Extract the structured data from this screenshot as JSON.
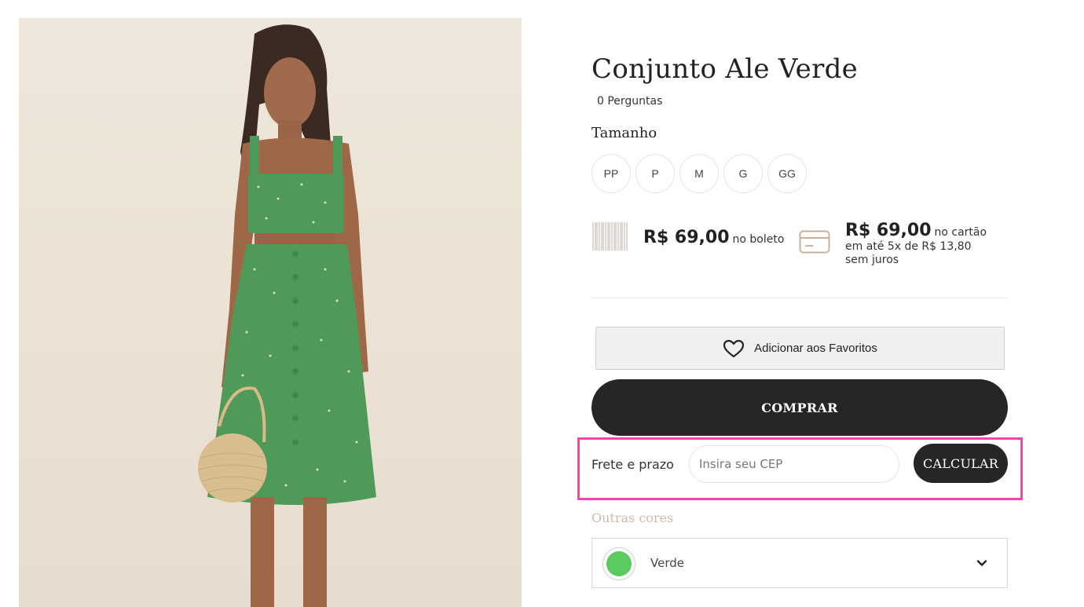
{
  "product": {
    "title": "Conjunto Ale Verde",
    "questions": "0 Perguntas",
    "size_label": "Tamanho",
    "sizes": [
      "PP",
      "P",
      "M",
      "G",
      "GG"
    ]
  },
  "pricing": {
    "boleto_price": "R$ 69,00",
    "boleto_note": "no boleto",
    "card_price": "R$ 69,00",
    "card_note": "no cartão",
    "installments": "em até 5x de R$ 13,80",
    "interest": "sem juros"
  },
  "actions": {
    "favorite_label": "Adicionar aos Favoritos",
    "buy_label": "COMPRAR"
  },
  "shipping": {
    "label": "Frete e prazo",
    "cep_placeholder": "Insira seu CEP",
    "calculate_label": "CALCULAR"
  },
  "colors": {
    "label": "Outras cores",
    "selected": "Verde",
    "swatch_color": "#5ccb5f"
  },
  "icons": {
    "heart": "heart-icon",
    "boleto": "barcode-icon",
    "card": "credit-card-icon",
    "chevron": "chevron-down-icon"
  },
  "theme": {
    "accent_highlight": "#ff3fac",
    "button_dark": "#262626",
    "muted_label": "#d1b9a6"
  }
}
